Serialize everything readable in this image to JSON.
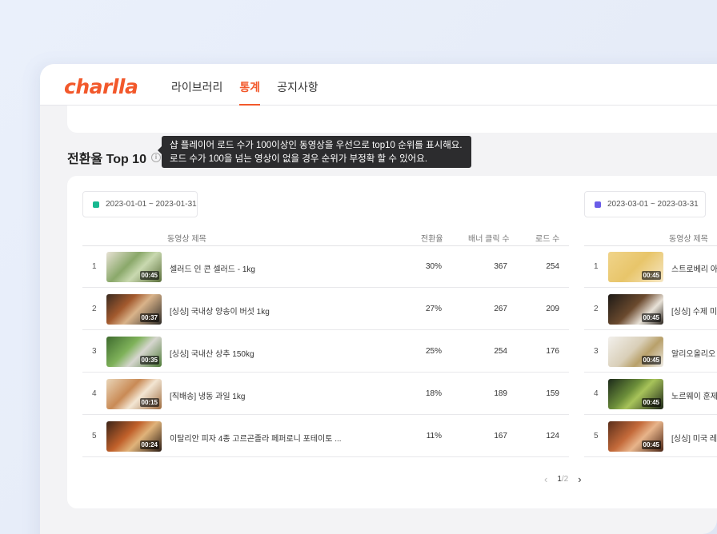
{
  "app": {
    "logo": "charlla"
  },
  "nav": [
    {
      "label": "라이브러리",
      "active": false
    },
    {
      "label": "통계",
      "active": true
    },
    {
      "label": "공지사항",
      "active": false
    }
  ],
  "section": {
    "title": "전환율 Top 10",
    "info_icon": "info-icon",
    "tooltip_line1": "샵 플레이어 로드 수가 100이상인 동영상을 우선으로 top10 순위를 표시해요.",
    "tooltip_line2": "로드 수가 100을 넘는 영상이 없을 경우 순위가 부정확 할 수 있어요."
  },
  "panel1": {
    "date_range": "2023-01-01 ~ 2023-01-31",
    "swatch_color": "#17b890",
    "headers": {
      "title": "동영상 제목",
      "conversion": "전환율",
      "clicks": "배너 클릭 수",
      "loads": "로드 수"
    },
    "rows": [
      {
        "rank": "1",
        "duration": "00:45",
        "title": "셀러드 인 콘 셀러드 - 1kg",
        "conversion": "30%",
        "clicks": "367",
        "loads": "254"
      },
      {
        "rank": "2",
        "duration": "00:37",
        "title": "[싱싱] 국내상 양송이 버섯 1kg",
        "conversion": "27%",
        "clicks": "267",
        "loads": "209"
      },
      {
        "rank": "3",
        "duration": "00:35",
        "title": "[싱싱] 국내산 상추 150kg",
        "conversion": "25%",
        "clicks": "254",
        "loads": "176"
      },
      {
        "rank": "4",
        "duration": "00:15",
        "title": "[직배송] 냉동 과일 1kg",
        "conversion": "18%",
        "clicks": "189",
        "loads": "159"
      },
      {
        "rank": "5",
        "duration": "00:24",
        "title": "이탈리안 피자 4종 고르곤졸라 페퍼로니 포테이토 ...",
        "conversion": "11%",
        "clicks": "167",
        "loads": "124"
      }
    ]
  },
  "panel2": {
    "date_range": "2023-03-01 ~ 2023-03-31",
    "swatch_color": "#6a5de8",
    "headers": {
      "title": "동영상 제목"
    },
    "rows": [
      {
        "rank": "1",
        "duration": "00:45",
        "title": "스트로베리 아"
      },
      {
        "rank": "2",
        "duration": "00:45",
        "title": "[싱싱] 수제 미"
      },
      {
        "rank": "3",
        "duration": "00:45",
        "title": "알리오올리오"
      },
      {
        "rank": "4",
        "duration": "00:45",
        "title": "노르웨이 훈제"
      },
      {
        "rank": "5",
        "duration": "00:45",
        "title": "[싱싱] 미국 레"
      }
    ]
  },
  "pager": {
    "current": "1",
    "total": "/2",
    "prev_icon": "chevron-left-icon",
    "next_icon": "chevron-right-icon"
  }
}
